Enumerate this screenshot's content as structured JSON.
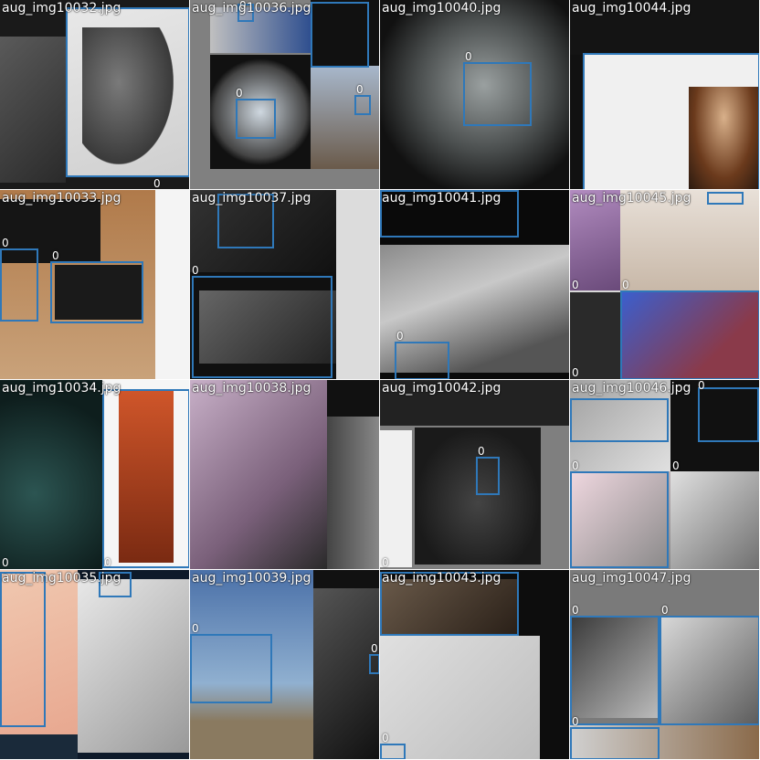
{
  "box_color": "#2f78b9",
  "tiles": [
    {
      "filename": "aug_img10032.jpg",
      "labels": [
        "0"
      ]
    },
    {
      "filename": "aug_img10036.jpg",
      "labels": [
        "0",
        "0",
        "0"
      ]
    },
    {
      "filename": "aug_img10040.jpg",
      "labels": [
        "0"
      ]
    },
    {
      "filename": "aug_img10044.jpg",
      "labels": []
    },
    {
      "filename": "aug_img10033.jpg",
      "labels": [
        "0",
        "0"
      ]
    },
    {
      "filename": "aug_img10037.jpg",
      "labels": [
        "0"
      ]
    },
    {
      "filename": "aug_img10041.jpg",
      "labels": [
        "0"
      ]
    },
    {
      "filename": "aug_img10045.jpg",
      "labels": [
        "0",
        "0",
        "0"
      ]
    },
    {
      "filename": "aug_img10034.jpg",
      "labels": [
        "0",
        "0"
      ]
    },
    {
      "filename": "aug_img10038.jpg",
      "labels": []
    },
    {
      "filename": "aug_img10042.jpg",
      "labels": [
        "0",
        "0"
      ]
    },
    {
      "filename": "aug_img10046.jpg",
      "labels": [
        "0",
        "0",
        "0"
      ]
    },
    {
      "filename": "aug_img10035.jpg",
      "labels": []
    },
    {
      "filename": "aug_img10039.jpg",
      "labels": [
        "0",
        "0"
      ]
    },
    {
      "filename": "aug_img10043.jpg",
      "labels": [
        "0"
      ]
    },
    {
      "filename": "aug_img10047.jpg",
      "labels": [
        "0",
        "0",
        "0"
      ]
    }
  ]
}
